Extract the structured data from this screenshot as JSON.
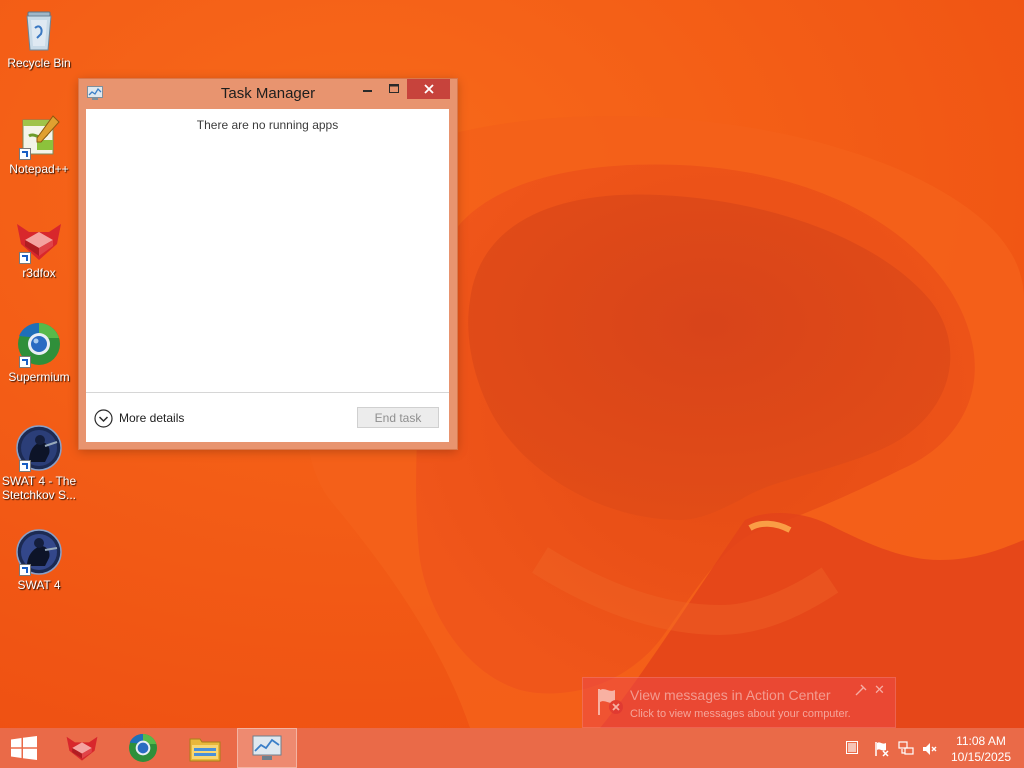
{
  "desktop": {
    "icons": [
      {
        "label": "Recycle Bin",
        "icon": "recycle-bin-icon"
      },
      {
        "label": "Notepad++",
        "icon": "notepad-plus-plus-icon"
      },
      {
        "label": "r3dfox",
        "icon": "r3dfox-icon"
      },
      {
        "label": "Supermium",
        "icon": "supermium-icon"
      },
      {
        "label": "SWAT 4 - The Stetchkov S...",
        "icon": "swat4-expansion-icon"
      },
      {
        "label": "SWAT 4",
        "icon": "swat4-icon"
      }
    ]
  },
  "task_manager": {
    "title": "Task Manager",
    "empty_message": "There are no running apps",
    "more_details_label": "More details",
    "end_task_label": "End task"
  },
  "toast": {
    "title": "View messages in Action Center",
    "body": "Click to view messages about your computer."
  },
  "taskbar": {
    "pinned": [
      "start-button",
      "r3dfox",
      "supermium",
      "file-explorer",
      "task-manager"
    ],
    "clock": {
      "time": "11:08 AM",
      "date": "10/15/2025"
    }
  },
  "colors": {
    "wallpaper": "#f25a16",
    "window_frame": "#e8946f",
    "close_button": "#c7433c",
    "taskbar": "#ea6a48"
  }
}
